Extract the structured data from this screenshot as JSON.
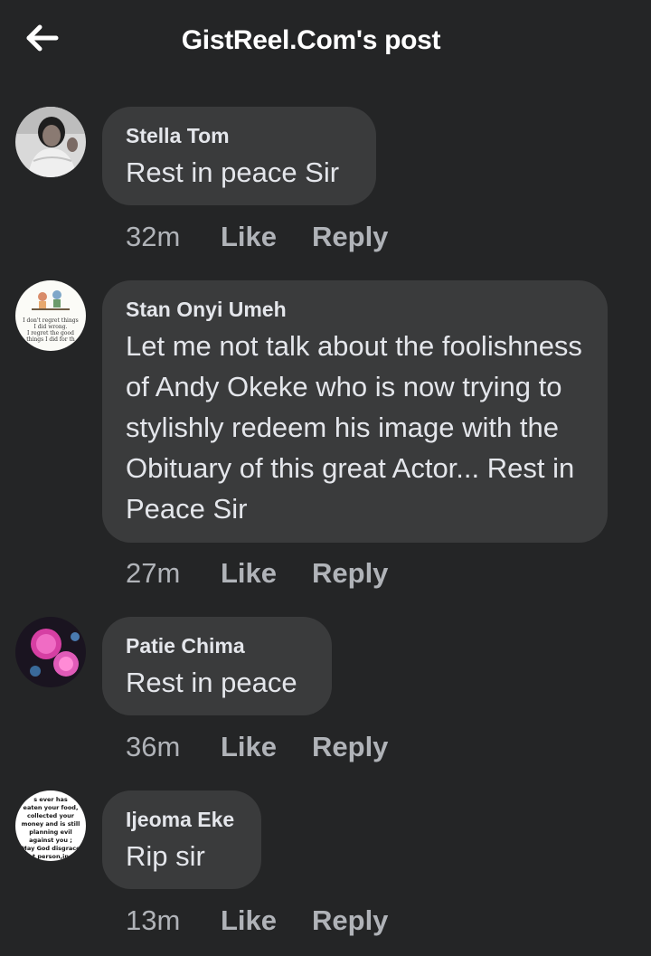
{
  "header": {
    "title": "GistReel.Com's post",
    "back_icon": "back-arrow-icon"
  },
  "comments": [
    {
      "author": "Stella Tom",
      "text": "Rest in peace Sir",
      "time": "32m",
      "like_label": "Like",
      "reply_label": "Reply"
    },
    {
      "author": "Stan Onyi Umeh",
      "text": "Let me not talk about the foolishness of Andy Okeke who is now trying to stylishly redeem his image with the Obituary of this great Actor... Rest in Peace Sir",
      "time": "27m",
      "like_label": "Like",
      "reply_label": "Reply",
      "avatar_text": "I don't regret things I did wrong. I regret the good things I did for th"
    },
    {
      "author": "Patie Chima",
      "text": "Rest in peace",
      "time": "36m",
      "like_label": "Like",
      "reply_label": "Reply"
    },
    {
      "author": "Ijeoma Eke",
      "text": "Rip sir",
      "time": "13m",
      "like_label": "Like",
      "reply_label": "Reply",
      "avatar_text": "s ever has eaten your food, collected your money and is still planning evil against you ; May God disgrace t person,in"
    }
  ],
  "colors": {
    "background": "#242526",
    "bubble": "#3a3b3c",
    "primary_text": "#e4e6eb",
    "secondary_text": "#b0b3b8"
  }
}
